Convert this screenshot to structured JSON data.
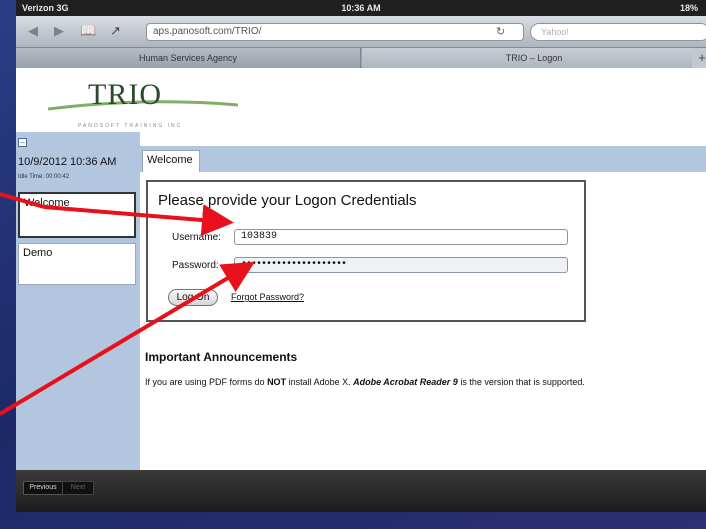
{
  "colors": {
    "slide_bg": "#1e2f6e",
    "sidebar": "#b3c6e0",
    "arrow": "#e8101a"
  },
  "status_bar": {
    "carrier": "Verizon 3G",
    "time": "10:36 AM",
    "battery": "18%"
  },
  "browser": {
    "url": "aps.panosoft.com/TRIO/",
    "search_placeholder": "Yahoo!",
    "tabs": [
      {
        "label": "Human Services Agency"
      },
      {
        "label": "TRIO – Logon"
      }
    ],
    "tab_close": "×",
    "tab_add": "+"
  },
  "header": {
    "logo_text": "TRIO",
    "logo_tagline": "PANOSOFT TRAINING INC"
  },
  "sidebar": {
    "datetime": "10/9/2012 10:36 AM",
    "idle_time": "Idle Time: 00:00:42",
    "items": [
      {
        "label": "Welcome"
      },
      {
        "label": "Demo"
      }
    ]
  },
  "main": {
    "tab_label": "Welcome",
    "login": {
      "title": "Please provide your Logon Credentials",
      "username_label": "Username:",
      "username_value": "103839",
      "password_label": "Password:",
      "password_value": "•••••••••••••••••••••",
      "logon_button": "Log On",
      "forgot_link": "Forgot Password?"
    },
    "announcements": {
      "heading": "Important Announcements",
      "text_before": "If you are using PDF forms do ",
      "text_not": "NOT",
      "text_middle": " install Adobe X. ",
      "text_reader": "Adobe Acrobat Reader 9",
      "text_after": " is the version that is supported."
    }
  },
  "footer": {
    "previous": "Previous",
    "next": "Next"
  }
}
